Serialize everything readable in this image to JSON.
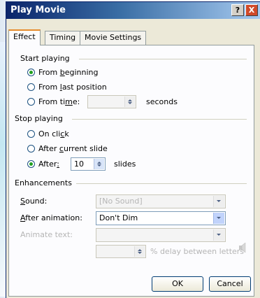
{
  "window": {
    "title": "Play Movie",
    "help_glyph": "?",
    "close_glyph": "X"
  },
  "tabs": [
    {
      "label": "Effect",
      "active": true
    },
    {
      "label": "Timing",
      "active": false
    },
    {
      "label": "Movie Settings",
      "active": false
    }
  ],
  "start_playing": {
    "title": "Start playing",
    "options": [
      {
        "pre": "From ",
        "u": "b",
        "post": "eginning",
        "checked": true
      },
      {
        "pre": "From ",
        "u": "l",
        "post": "ast position",
        "checked": false
      },
      {
        "pre": "From ti",
        "u": "m",
        "post": "e:",
        "checked": false
      }
    ],
    "time_value": "",
    "seconds_label": "seconds"
  },
  "stop_playing": {
    "title": "Stop playing",
    "options": [
      {
        "pre": "On cli",
        "u": "c",
        "post": "k",
        "checked": false
      },
      {
        "pre": "After ",
        "u": "c",
        "post": "urrent slide",
        "checked": false
      },
      {
        "pre": "After",
        "u": ":",
        "post": "",
        "checked": true
      }
    ],
    "slides_value": "10",
    "slides_label": "slides"
  },
  "enhancements": {
    "title": "Enhancements",
    "sound_label": {
      "u": "S",
      "post": "ound:"
    },
    "sound_value": "[No Sound]",
    "after_animation_label": {
      "u": "A",
      "post": "fter animation:"
    },
    "after_animation_value": "Don't Dim",
    "animate_text_label": "Animate text:",
    "animate_text_value": "",
    "delay_value": "",
    "delay_suffix": "% delay between letters"
  },
  "buttons": {
    "ok": "OK",
    "cancel": "Cancel"
  },
  "colors": {
    "title_bar": "#0a246a",
    "dialog_bg": "#ece9d8",
    "panel_bg": "#fcfcfe",
    "tab_highlight": "#e68b2c"
  }
}
